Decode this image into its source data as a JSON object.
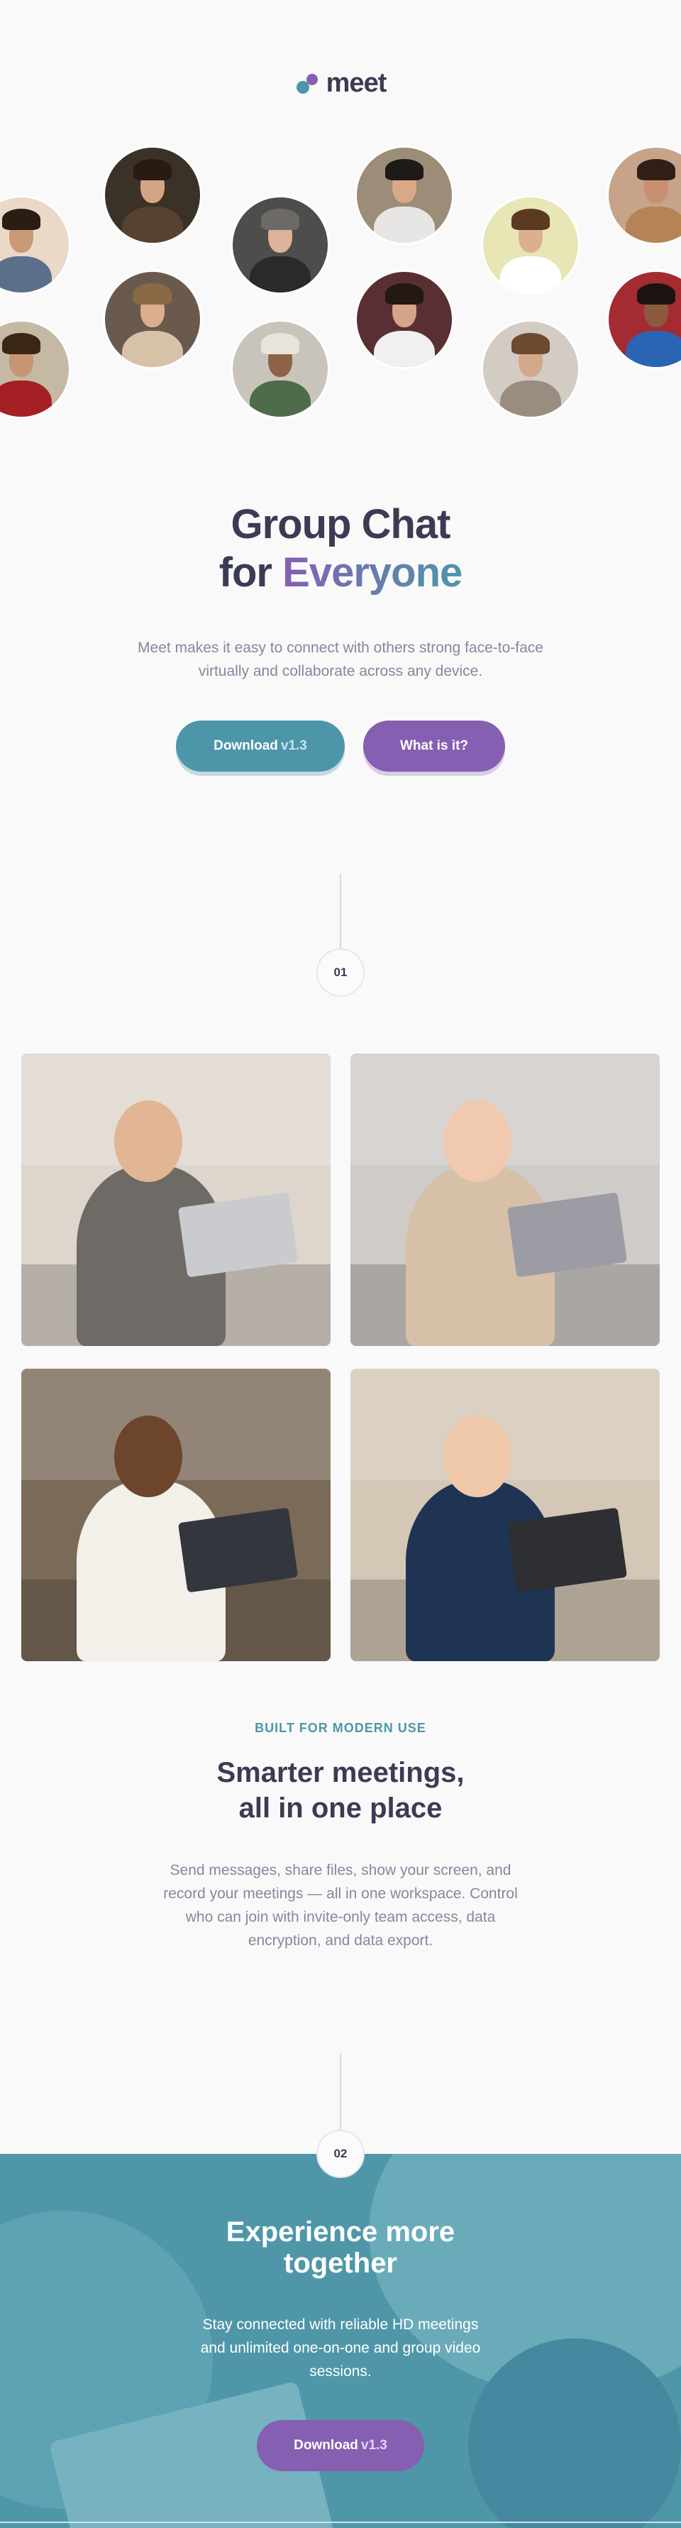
{
  "brand": {
    "name": "meet",
    "colors": {
      "teal": "#4d96a9",
      "purple": "#855fb1",
      "dark": "#3b3c53",
      "muted": "#87879d"
    }
  },
  "avatars": [
    {
      "name": "avatar-1",
      "bg": "#ead9c6",
      "skin": "#c99a77",
      "hair": "#2a1d14",
      "shirt": "#5c6f8a"
    },
    {
      "name": "avatar-2",
      "bg": "#c5b9a4",
      "skin": "#c89573",
      "hair": "#3a2617",
      "shirt": "#a52025"
    },
    {
      "name": "avatar-3",
      "bg": "#3a3226",
      "skin": "#d4a584",
      "hair": "#2a1b12",
      "shirt": "#56422f"
    },
    {
      "name": "avatar-4",
      "bg": "#6a5a4e",
      "skin": "#ddae8e",
      "hair": "#8a6a45",
      "shirt": "#d6c2a6"
    },
    {
      "name": "avatar-5",
      "bg": "#4d4e4b",
      "skin": "#dcb39a",
      "hair": "#6d6a66",
      "shirt": "#2a2a2a"
    },
    {
      "name": "avatar-6",
      "bg": "#c9c4bb",
      "skin": "#8f6147",
      "hair": "#e8e4dc",
      "shirt": "#4e6b4a"
    },
    {
      "name": "avatar-7",
      "bg": "#9c8d78",
      "skin": "#d9a986",
      "hair": "#1e1a18",
      "shirt": "#e8e6e4"
    },
    {
      "name": "avatar-8",
      "bg": "#5a2f33",
      "skin": "#d7a38a",
      "hair": "#241812",
      "shirt": "#f0f0f0"
    },
    {
      "name": "avatar-9",
      "bg": "#e8e6b5",
      "skin": "#dcb08f",
      "hair": "#5a3a22",
      "shirt": "#ffffff"
    },
    {
      "name": "avatar-10",
      "bg": "#d3ccc4",
      "skin": "#d5a78a",
      "hair": "#6b4a2e",
      "shirt": "#9a8d80"
    },
    {
      "name": "avatar-11",
      "bg": "#c7a489",
      "skin": "#c8906e",
      "hair": "#2e2016",
      "shirt": "#b48456"
    },
    {
      "name": "avatar-12",
      "bg": "#a52b33",
      "skin": "#8c5a3e",
      "hair": "#1b1410",
      "shirt": "#2a65b3"
    }
  ],
  "hero": {
    "title_line1": "Group Chat",
    "title_line2_prefix": "for",
    "title_line2_accent": "Everyone",
    "description": "Meet makes it easy to connect with others strong face-to-face virtually and collaborate across any device.",
    "download_label": "Download",
    "download_version": "v1.3",
    "what_label": "What is it?"
  },
  "dividers": {
    "first": "01",
    "second": "02"
  },
  "photos": [
    {
      "name": "photo-woman-laptop",
      "bg": "#ded6cc",
      "accent": "#6e6a66",
      "skin": "#e2b594",
      "device": "#c9cbcf"
    },
    {
      "name": "photo-women-phone",
      "bg": "#cfcbc7",
      "accent": "#d6c1a8",
      "skin": "#f0c9ae",
      "device": "#9c9ca4"
    },
    {
      "name": "photo-man-phone",
      "bg": "#7a6a58",
      "accent": "#f3f0ea",
      "skin": "#6d452c",
      "device": "#33363c"
    },
    {
      "name": "photo-video-call",
      "bg": "#d4c7b6",
      "accent": "#1f3353",
      "skin": "#f0c8aa",
      "device": "#2d2f33"
    }
  ],
  "features": {
    "eyebrow": "BUILT FOR MODERN USE",
    "title_line1": "Smarter meetings,",
    "title_line2": "all in one place",
    "description": "Send messages, share files, show your screen, and record your meetings — all in one workspace. Control who can join with invite-only team access, data encryption, and data export."
  },
  "cta": {
    "title_line1": "Experience more",
    "title_line2": "together",
    "description": "Stay connected with reliable HD meetings and unlimited one-on-one and group video sessions.",
    "download_label": "Download",
    "download_version": "v1.3",
    "band_color": "#4f97a8"
  }
}
